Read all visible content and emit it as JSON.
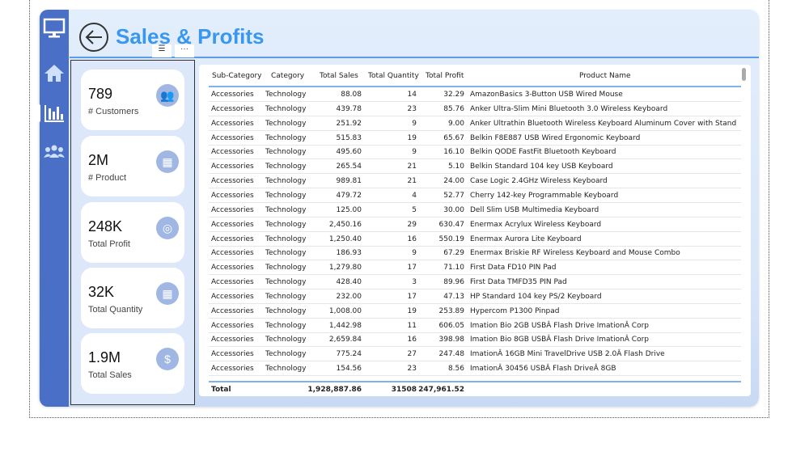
{
  "header": {
    "title": "Sales & Profits",
    "back_icon": "arrow-left-icon",
    "filter_icon": "filter-icon",
    "more_icon": "more-icon"
  },
  "sidebar": {
    "items": [
      {
        "icon": "monitor-icon"
      },
      {
        "icon": "home-icon"
      },
      {
        "icon": "bar-chart-icon",
        "active": true
      },
      {
        "icon": "users-icon"
      }
    ]
  },
  "cards": [
    {
      "value": "789",
      "label": "# Customers",
      "icon": "customers-icon"
    },
    {
      "value": "2M",
      "label": "# Product",
      "icon": "boxes-icon"
    },
    {
      "value": "248K",
      "label": "Total Profit",
      "icon": "coins-icon"
    },
    {
      "value": "32K",
      "label": "Total Quantity",
      "icon": "boxes-icon"
    },
    {
      "value": "1.9M",
      "label": "Total Sales",
      "icon": "dollar-icon"
    }
  ],
  "table": {
    "columns": [
      "Sub-Category",
      "Category",
      "Total Sales",
      "Total Quantity",
      "Total Profit",
      "Product Name"
    ],
    "rows": [
      [
        "Accessories",
        "Technology",
        "88.08",
        "14",
        "32.29",
        "AmazonBasics 3-Button USB Wired Mouse"
      ],
      [
        "Accessories",
        "Technology",
        "439.78",
        "23",
        "85.76",
        "Anker Ultra-Slim Mini Bluetooth 3.0 Wireless Keyboard"
      ],
      [
        "Accessories",
        "Technology",
        "251.92",
        "9",
        "9.00",
        "Anker Ultrathin Bluetooth Wireless Keyboard Aluminum Cover with Stand"
      ],
      [
        "Accessories",
        "Technology",
        "515.83",
        "19",
        "65.67",
        "Belkin F8E887 USB Wired Ergonomic Keyboard"
      ],
      [
        "Accessories",
        "Technology",
        "495.60",
        "9",
        "16.10",
        "Belkin QODE FastFit Bluetooth Keyboard"
      ],
      [
        "Accessories",
        "Technology",
        "265.54",
        "21",
        "5.10",
        "Belkin Standard 104 key USB Keyboard"
      ],
      [
        "Accessories",
        "Technology",
        "989.81",
        "21",
        "24.00",
        "Case Logic 2.4GHz Wireless Keyboard"
      ],
      [
        "Accessories",
        "Technology",
        "479.72",
        "4",
        "52.77",
        "Cherry 142-key Programmable Keyboard"
      ],
      [
        "Accessories",
        "Technology",
        "125.00",
        "5",
        "30.00",
        "Dell Slim USB Multimedia Keyboard"
      ],
      [
        "Accessories",
        "Technology",
        "2,450.16",
        "29",
        "630.47",
        "Enermax Acrylux Wireless Keyboard"
      ],
      [
        "Accessories",
        "Technology",
        "1,250.40",
        "16",
        "550.19",
        "Enermax Aurora Lite Keyboard"
      ],
      [
        "Accessories",
        "Technology",
        "186.93",
        "9",
        "67.29",
        "Enermax Briskie RF Wireless Keyboard and Mouse Combo"
      ],
      [
        "Accessories",
        "Technology",
        "1,279.80",
        "17",
        "71.10",
        "First Data FD10 PIN Pad"
      ],
      [
        "Accessories",
        "Technology",
        "428.40",
        "3",
        "89.96",
        "First Data TMFD35 PIN Pad"
      ],
      [
        "Accessories",
        "Technology",
        "232.00",
        "17",
        "47.13",
        "HP Standard 104 key PS/2 Keyboard"
      ],
      [
        "Accessories",
        "Technology",
        "1,008.00",
        "19",
        "253.89",
        "Hypercom P1300 Pinpad"
      ],
      [
        "Accessories",
        "Technology",
        "1,442.98",
        "11",
        "606.05",
        "Imation Bio 2GB USBÂ Flash Drive ImationÂ Corp"
      ],
      [
        "Accessories",
        "Technology",
        "2,659.84",
        "16",
        "398.98",
        "Imation Bio 8GB USBÂ Flash Drive ImationÂ Corp"
      ],
      [
        "Accessories",
        "Technology",
        "775.24",
        "27",
        "247.48",
        "ImationÂ 16GB Mini TravelDrive USB 2.0Â Flash Drive"
      ],
      [
        "Accessories",
        "Technology",
        "154.56",
        "23",
        "8.56",
        "ImationÂ 30456 USBÂ Flash DriveÂ 8GB"
      ]
    ],
    "total": {
      "label": "Total",
      "sales": "1,928,887.86",
      "quantity": "31508",
      "profit": "247,961.52"
    }
  },
  "colors": {
    "accent": "#3a97ef",
    "sidebar": "#4a6fc6",
    "icon_circle": "#9fb7e2"
  }
}
